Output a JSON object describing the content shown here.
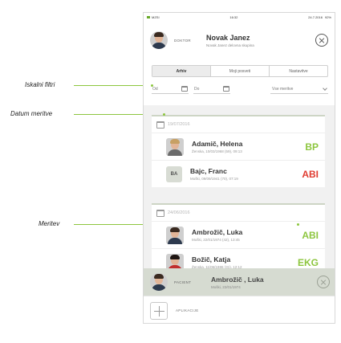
{
  "status_bar": {
    "carrier": "MZSI",
    "time": "16:32",
    "date": "24.7.2016",
    "battery": "92%"
  },
  "header": {
    "role": "DOKTOR",
    "doctor_name": "Novak Janez",
    "doctor_sub": "Novak Janez delovna skupina",
    "close_icon": "close-circle-icon"
  },
  "tabs": [
    {
      "label": "Arhiv",
      "active": true
    },
    {
      "label": "Moji posveti",
      "active": false
    },
    {
      "label": "Nastavitve",
      "active": false
    }
  ],
  "filters": {
    "from_placeholder": "Od",
    "to_placeholder": "Do",
    "select_value": "Vse meritve"
  },
  "groups": [
    {
      "date": "19/07/2016",
      "rows": [
        {
          "name": "Adamič, Helena",
          "sub": "Ženska, 10/03/1968 (59), 09:13",
          "code": "BP",
          "code_color": "#8dc63f",
          "avatar": "photo"
        },
        {
          "name": "Bajc, Franc",
          "sub": "Moški, 09/09/1941 (70), 07:19",
          "code": "ABI",
          "code_color": "#e03c31",
          "avatar": "initials",
          "initials": "BA"
        }
      ]
    },
    {
      "date": "24/06/2016",
      "rows": [
        {
          "name": "Ambrožič, Luka",
          "sub": "Moški, 22/01/1974 (42), 13:45",
          "code": "ABI",
          "code_color": "#8dc63f",
          "avatar": "photo"
        },
        {
          "name": "Božič, Katja",
          "sub": "Ženska, 11/06/1986 (31), 12:12",
          "code": "EKG",
          "code_color": "#8dc63f",
          "avatar": "photo"
        }
      ]
    }
  ],
  "selected_patient": {
    "role": "PACIENT",
    "name": "Ambrožič , Luka",
    "sub": "Moški, 22/01/1974"
  },
  "app_bar": {
    "label": "APLIKACIJE"
  },
  "annotations": [
    {
      "label": "Iskalni filtri"
    },
    {
      "label": "Datum meritve"
    },
    {
      "label": "Meritev"
    }
  ],
  "colors": {
    "accent_green": "#8dc63f",
    "alert_red": "#e03c31"
  }
}
